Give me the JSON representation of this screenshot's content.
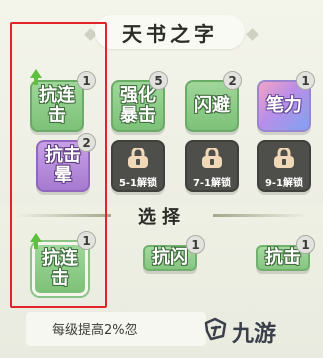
{
  "header": {
    "title": "天书之字"
  },
  "grid": {
    "tiles": [
      {
        "label": "抗连\n击",
        "count": "1"
      },
      {
        "label": "强化\n暴击",
        "count": "5"
      },
      {
        "label": "闪避",
        "count": "2"
      },
      {
        "label": "笔力",
        "count": "1"
      },
      {
        "label": "抗击\n晕",
        "count": "2"
      }
    ],
    "locked": [
      {
        "label": "5-1解锁"
      },
      {
        "label": "7-1解锁"
      },
      {
        "label": "9-1解锁"
      }
    ]
  },
  "selection": {
    "title": "选择",
    "slots": [
      {
        "label": "抗连\n击",
        "count": "1"
      },
      {
        "label": "抗闪",
        "count": "1"
      },
      {
        "label": "抗击",
        "count": "1"
      }
    ]
  },
  "description": {
    "text": "每级提高2%忽"
  },
  "watermark": {
    "text": "九游"
  },
  "colors": {
    "highlight": "#e0242a",
    "green_tile": "#8ccb87",
    "purple_tile": "#b58be0",
    "locked_tile": "#4e4e4a"
  }
}
